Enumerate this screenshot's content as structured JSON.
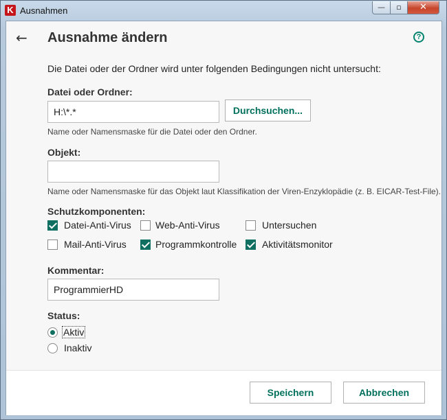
{
  "window": {
    "title": "Ausnahmen",
    "app_icon_letter": "K",
    "minimize": "—",
    "maximize": "▫",
    "close": "✕"
  },
  "header": {
    "back_icon": "←",
    "title": "Ausnahme ändern",
    "help_icon": "?"
  },
  "description": "Die Datei oder der Ordner wird unter folgenden Bedingungen nicht untersucht:",
  "file_or_folder": {
    "label": "Datei oder Ordner:",
    "value": "H:\\*.*",
    "browse_label": "Durchsuchen...",
    "hint": "Name oder Namensmaske für die Datei oder den Ordner."
  },
  "object": {
    "label": "Objekt:",
    "value": "",
    "hint": "Name oder Namensmaske für das Objekt laut Klassifikation der Viren-Enzyklopädie (z. B. EICAR-Test-File)."
  },
  "components": {
    "label": "Schutzkomponenten:",
    "items": [
      {
        "label": "Datei-Anti-Virus",
        "checked": true
      },
      {
        "label": "Web-Anti-Virus",
        "checked": false
      },
      {
        "label": "Untersuchen",
        "checked": false
      },
      {
        "label": "Mail-Anti-Virus",
        "checked": false
      },
      {
        "label": "Programmkontrolle",
        "checked": true
      },
      {
        "label": "Aktivitätsmonitor",
        "checked": true
      }
    ]
  },
  "comment": {
    "label": "Kommentar:",
    "value": "ProgrammierHD"
  },
  "status": {
    "label": "Status:",
    "options": [
      {
        "label": "Aktiv",
        "selected": true
      },
      {
        "label": "Inaktiv",
        "selected": false
      }
    ]
  },
  "footer": {
    "save_label": "Speichern",
    "cancel_label": "Abbrechen"
  },
  "colors": {
    "accent": "#00705d",
    "checkbox_fill": "#0f6f60",
    "close_button": "#c7452b"
  }
}
